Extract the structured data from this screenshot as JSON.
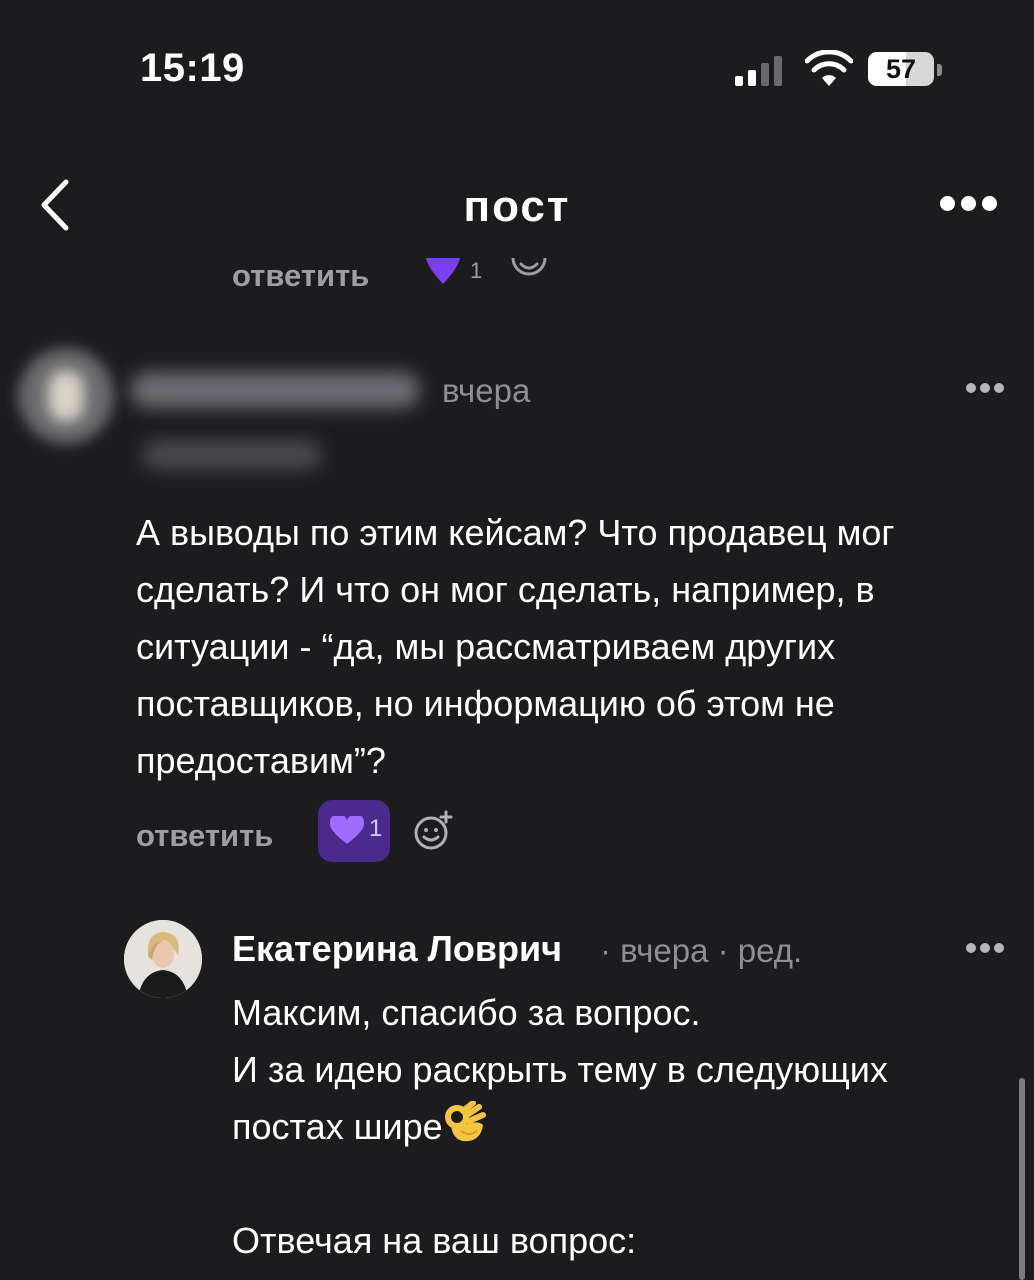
{
  "status_bar": {
    "time": "15:19",
    "battery": "57",
    "battery_level": 0.57
  },
  "header": {
    "title": "пост",
    "back_icon": "chevron-left-icon",
    "more_icon": "more-horizontal-icon"
  },
  "prev_comment_actions": {
    "reply_label": "ответить",
    "like_count": "1"
  },
  "comment": {
    "time": "вчера",
    "text_lines": [
      "А выводы по этим кейсам? Что продавец мог",
      "сделать? И что он мог сделать, например, в",
      "ситуации -  “да, мы рассматриваем других",
      "поставщиков, но информацию об этом не",
      "предоставим”?"
    ],
    "reply_label": "ответить",
    "like_count": "1"
  },
  "reply": {
    "author": "Екатерина Ловрич",
    "meta": "· вчера · ред.",
    "text_lines": [
      "Максим, спасибо за вопрос.",
      "И за идею раскрыть тему в следующих",
      "постах шире"
    ],
    "text_after": "Отвечая на ваш вопрос:",
    "emoji": "ok-hand-emoji"
  },
  "colors": {
    "background": "#1c1c1e",
    "accent": "#7b3ff2",
    "muted": "#9e9ea3"
  }
}
